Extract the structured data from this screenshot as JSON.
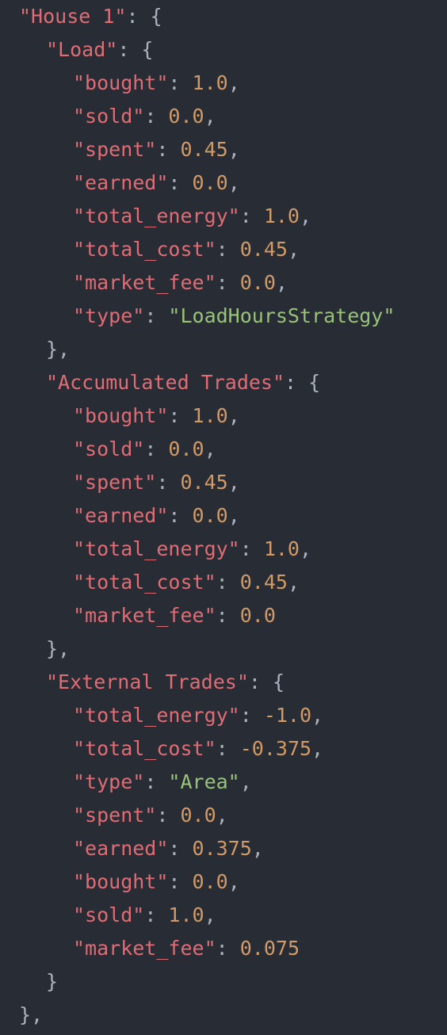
{
  "colors": {
    "background": "#282c34",
    "punctuation": "#abb2bf",
    "key": "#e06c75",
    "string": "#98c379",
    "number": "#d19a66"
  },
  "lines": [
    {
      "indent": 1,
      "parts": [
        {
          "t": "key",
          "v": "\"House 1\""
        },
        {
          "t": "punct",
          "v": ": {"
        }
      ]
    },
    {
      "indent": 2,
      "parts": [
        {
          "t": "key",
          "v": "\"Load\""
        },
        {
          "t": "punct",
          "v": ": {"
        }
      ]
    },
    {
      "indent": 3,
      "parts": [
        {
          "t": "key",
          "v": "\"bought\""
        },
        {
          "t": "punct",
          "v": ": "
        },
        {
          "t": "num",
          "v": "1.0"
        },
        {
          "t": "punct",
          "v": ","
        }
      ]
    },
    {
      "indent": 3,
      "parts": [
        {
          "t": "key",
          "v": "\"sold\""
        },
        {
          "t": "punct",
          "v": ": "
        },
        {
          "t": "num",
          "v": "0.0"
        },
        {
          "t": "punct",
          "v": ","
        }
      ]
    },
    {
      "indent": 3,
      "parts": [
        {
          "t": "key",
          "v": "\"spent\""
        },
        {
          "t": "punct",
          "v": ": "
        },
        {
          "t": "num",
          "v": "0.45"
        },
        {
          "t": "punct",
          "v": ","
        }
      ]
    },
    {
      "indent": 3,
      "parts": [
        {
          "t": "key",
          "v": "\"earned\""
        },
        {
          "t": "punct",
          "v": ": "
        },
        {
          "t": "num",
          "v": "0.0"
        },
        {
          "t": "punct",
          "v": ","
        }
      ]
    },
    {
      "indent": 3,
      "parts": [
        {
          "t": "key",
          "v": "\"total_energy\""
        },
        {
          "t": "punct",
          "v": ": "
        },
        {
          "t": "num",
          "v": "1.0"
        },
        {
          "t": "punct",
          "v": ","
        }
      ]
    },
    {
      "indent": 3,
      "parts": [
        {
          "t": "key",
          "v": "\"total_cost\""
        },
        {
          "t": "punct",
          "v": ": "
        },
        {
          "t": "num",
          "v": "0.45"
        },
        {
          "t": "punct",
          "v": ","
        }
      ]
    },
    {
      "indent": 3,
      "parts": [
        {
          "t": "key",
          "v": "\"market_fee\""
        },
        {
          "t": "punct",
          "v": ": "
        },
        {
          "t": "num",
          "v": "0.0"
        },
        {
          "t": "punct",
          "v": ","
        }
      ]
    },
    {
      "indent": 3,
      "parts": [
        {
          "t": "key",
          "v": "\"type\""
        },
        {
          "t": "punct",
          "v": ": "
        },
        {
          "t": "str",
          "v": "\"LoadHoursStrategy\""
        }
      ]
    },
    {
      "indent": 2,
      "parts": [
        {
          "t": "punct",
          "v": "},"
        }
      ]
    },
    {
      "indent": 2,
      "parts": [
        {
          "t": "key",
          "v": "\"Accumulated Trades\""
        },
        {
          "t": "punct",
          "v": ": {"
        }
      ]
    },
    {
      "indent": 3,
      "parts": [
        {
          "t": "key",
          "v": "\"bought\""
        },
        {
          "t": "punct",
          "v": ": "
        },
        {
          "t": "num",
          "v": "1.0"
        },
        {
          "t": "punct",
          "v": ","
        }
      ]
    },
    {
      "indent": 3,
      "parts": [
        {
          "t": "key",
          "v": "\"sold\""
        },
        {
          "t": "punct",
          "v": ": "
        },
        {
          "t": "num",
          "v": "0.0"
        },
        {
          "t": "punct",
          "v": ","
        }
      ]
    },
    {
      "indent": 3,
      "parts": [
        {
          "t": "key",
          "v": "\"spent\""
        },
        {
          "t": "punct",
          "v": ": "
        },
        {
          "t": "num",
          "v": "0.45"
        },
        {
          "t": "punct",
          "v": ","
        }
      ]
    },
    {
      "indent": 3,
      "parts": [
        {
          "t": "key",
          "v": "\"earned\""
        },
        {
          "t": "punct",
          "v": ": "
        },
        {
          "t": "num",
          "v": "0.0"
        },
        {
          "t": "punct",
          "v": ","
        }
      ]
    },
    {
      "indent": 3,
      "parts": [
        {
          "t": "key",
          "v": "\"total_energy\""
        },
        {
          "t": "punct",
          "v": ": "
        },
        {
          "t": "num",
          "v": "1.0"
        },
        {
          "t": "punct",
          "v": ","
        }
      ]
    },
    {
      "indent": 3,
      "parts": [
        {
          "t": "key",
          "v": "\"total_cost\""
        },
        {
          "t": "punct",
          "v": ": "
        },
        {
          "t": "num",
          "v": "0.45"
        },
        {
          "t": "punct",
          "v": ","
        }
      ]
    },
    {
      "indent": 3,
      "parts": [
        {
          "t": "key",
          "v": "\"market_fee\""
        },
        {
          "t": "punct",
          "v": ": "
        },
        {
          "t": "num",
          "v": "0.0"
        }
      ]
    },
    {
      "indent": 2,
      "parts": [
        {
          "t": "punct",
          "v": "},"
        }
      ]
    },
    {
      "indent": 2,
      "parts": [
        {
          "t": "key",
          "v": "\"External Trades\""
        },
        {
          "t": "punct",
          "v": ": {"
        }
      ]
    },
    {
      "indent": 3,
      "parts": [
        {
          "t": "key",
          "v": "\"total_energy\""
        },
        {
          "t": "punct",
          "v": ": "
        },
        {
          "t": "num",
          "v": "-1.0"
        },
        {
          "t": "punct",
          "v": ","
        }
      ]
    },
    {
      "indent": 3,
      "parts": [
        {
          "t": "key",
          "v": "\"total_cost\""
        },
        {
          "t": "punct",
          "v": ": "
        },
        {
          "t": "num",
          "v": "-0.375"
        },
        {
          "t": "punct",
          "v": ","
        }
      ]
    },
    {
      "indent": 3,
      "parts": [
        {
          "t": "key",
          "v": "\"type\""
        },
        {
          "t": "punct",
          "v": ": "
        },
        {
          "t": "str",
          "v": "\"Area\""
        },
        {
          "t": "punct",
          "v": ","
        }
      ]
    },
    {
      "indent": 3,
      "parts": [
        {
          "t": "key",
          "v": "\"spent\""
        },
        {
          "t": "punct",
          "v": ": "
        },
        {
          "t": "num",
          "v": "0.0"
        },
        {
          "t": "punct",
          "v": ","
        }
      ]
    },
    {
      "indent": 3,
      "parts": [
        {
          "t": "key",
          "v": "\"earned\""
        },
        {
          "t": "punct",
          "v": ": "
        },
        {
          "t": "num",
          "v": "0.375"
        },
        {
          "t": "punct",
          "v": ","
        }
      ]
    },
    {
      "indent": 3,
      "parts": [
        {
          "t": "key",
          "v": "\"bought\""
        },
        {
          "t": "punct",
          "v": ": "
        },
        {
          "t": "num",
          "v": "0.0"
        },
        {
          "t": "punct",
          "v": ","
        }
      ]
    },
    {
      "indent": 3,
      "parts": [
        {
          "t": "key",
          "v": "\"sold\""
        },
        {
          "t": "punct",
          "v": ": "
        },
        {
          "t": "num",
          "v": "1.0"
        },
        {
          "t": "punct",
          "v": ","
        }
      ]
    },
    {
      "indent": 3,
      "parts": [
        {
          "t": "key",
          "v": "\"market_fee\""
        },
        {
          "t": "punct",
          "v": ": "
        },
        {
          "t": "num",
          "v": "0.075"
        }
      ]
    },
    {
      "indent": 2,
      "parts": [
        {
          "t": "punct",
          "v": "}"
        }
      ]
    },
    {
      "indent": 1,
      "parts": [
        {
          "t": "punct",
          "v": "},"
        }
      ]
    }
  ]
}
